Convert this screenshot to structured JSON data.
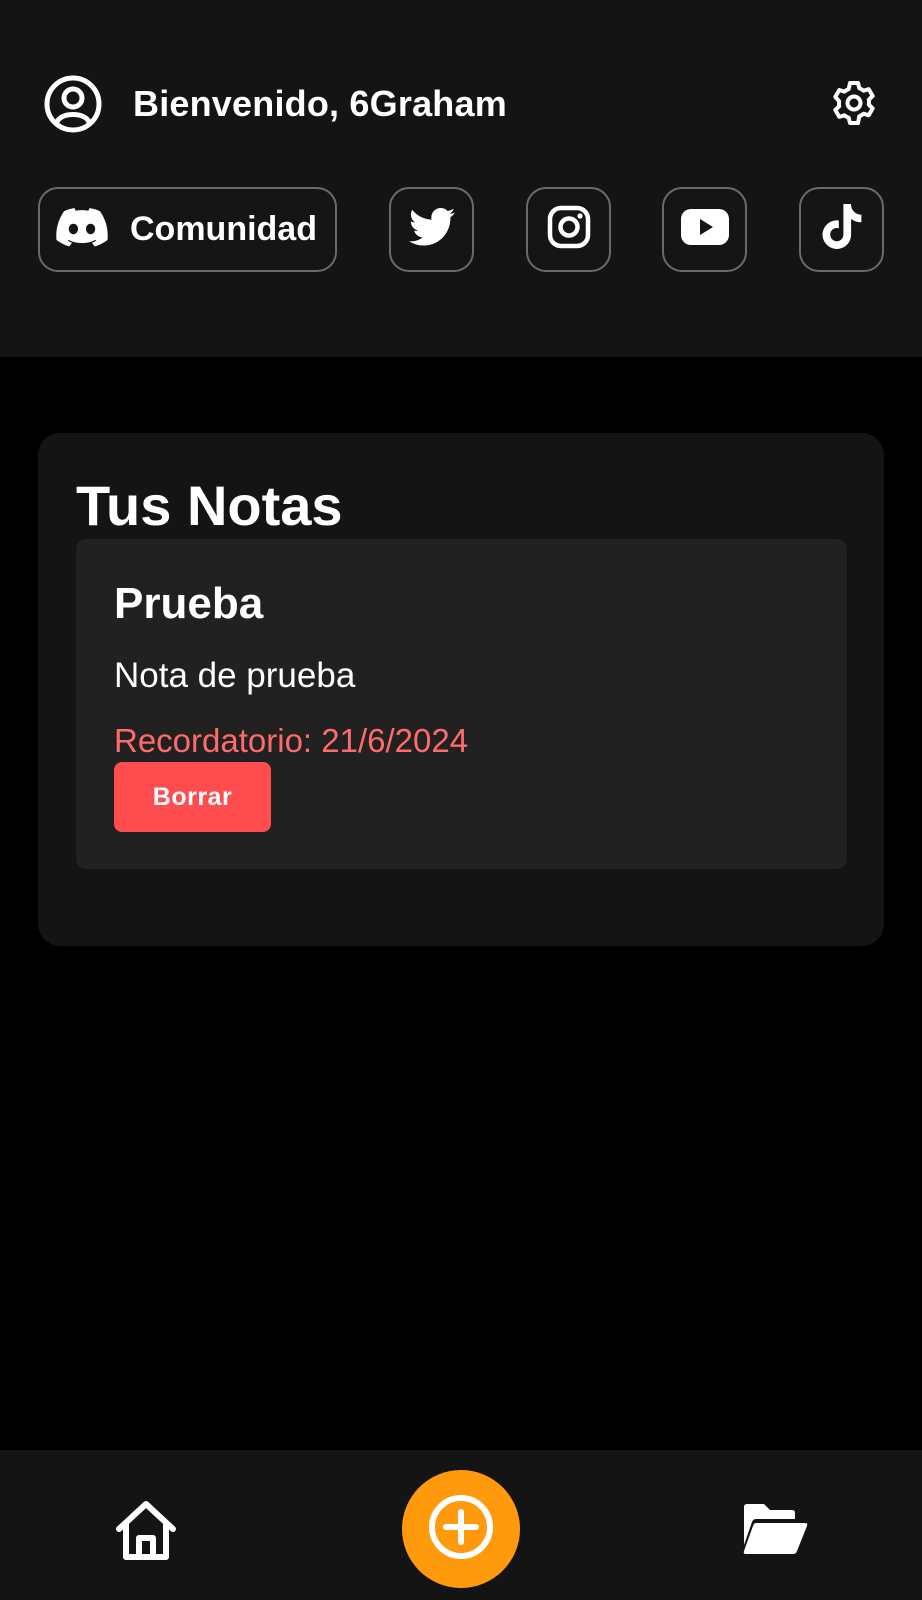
{
  "header": {
    "welcome_text": "Bienvenido, 6Graham",
    "avatar_icon": "user-circle-icon",
    "settings_icon": "gear-icon"
  },
  "social": {
    "community_label": "Comunidad",
    "community_icon": "discord-icon",
    "buttons": [
      {
        "icon": "twitter-icon"
      },
      {
        "icon": "instagram-icon"
      },
      {
        "icon": "youtube-icon"
      },
      {
        "icon": "tiktok-icon"
      }
    ]
  },
  "notes_section": {
    "title": "Tus Notas",
    "notes": [
      {
        "title": "Prueba",
        "body": "Nota de prueba",
        "reminder": "Recordatorio: 21/6/2024",
        "delete_label": "Borrar"
      }
    ]
  },
  "bottom_nav": {
    "home_icon": "home-icon",
    "add_icon": "plus-circle-icon",
    "folder_icon": "folder-open-icon"
  },
  "colors": {
    "background": "#000000",
    "panel": "#141414",
    "note_card": "#212121",
    "accent_orange": "#ff9a0d",
    "danger": "#ff4d4f",
    "reminder": "#ff6b6b"
  }
}
